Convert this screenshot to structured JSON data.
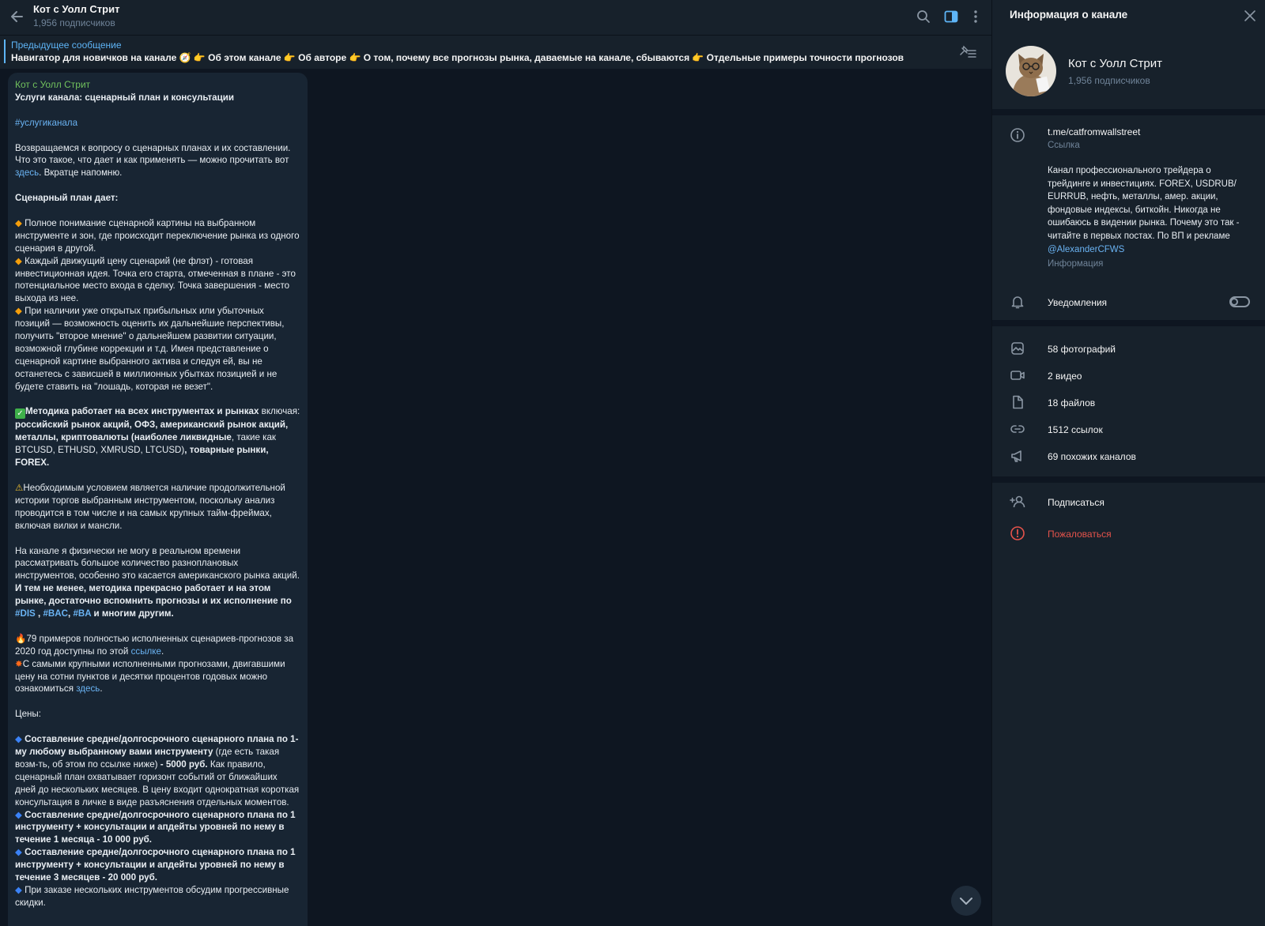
{
  "header": {
    "title": "Кот с Уолл Стрит",
    "subtitle": "1,956 подписчиков"
  },
  "pinned": {
    "label": "Предыдущее сообщение",
    "text": "Навигатор для новичков на канале 🧭 👉 Об этом канале 👉 Об авторе 👉 О том, почему все прогнозы рынка, даваемые на канале, сбываются 👉 Отдельные примеры точности прогнозов"
  },
  "message": {
    "author": "Кот с Уолл Стрит",
    "title": "Услуги канала: сценарный план и консультации",
    "hashtag": "#услугиканала",
    "p1_a": "Возвращаемся к вопросу о сценарных планах и их составлении. Что это такое, что дает и как применять — можно прочитать вот ",
    "p1_link": "здесь",
    "p1_b": ". Вкратце напомню.",
    "h_plan": "Сценарный план дает:",
    "b1": "Полное понимание сценарной картины на выбранном инструменте и зон, где происходит переключение рынка из одного сценария в другой.",
    "b2": "Каждый движущий цену сценарий (не флэт) - готовая инвестиционная идея. Точка его старта, отмеченная в плане - это потенциальное место входа в сделку. Точка завершения - место выхода из нее.",
    "b3": "При наличии уже открытых прибыльных или убыточных позиций — возможность оценить их дальнейшие перспективы, получить \"второе мнение\" о дальнейшем развитии ситуации, возможной глубине коррекции и т.д. Имея представление о сценарной картине выбранного актива и следуя ей, вы не останетесь с зависшей в миллионных убытках позицией и не будете  ставить на \"лошадь, которая не везет\".",
    "m_a": "Методика работает на всех инструментах и рынках",
    "m_b": " включая: ",
    "m_c": "российский рынок акций, ОФЗ, американский рынок акций, металлы, криптовалюты (наиболее ликвидные",
    "m_d": ", такие как BTCUSD, ETHUSD, XMRUSD, LTCUSD)",
    "m_e": ", товарные рынки, FOREX.",
    "warn": "Необходимым условием является наличие продолжительной истории торгов выбранным инструментом, поскольку анализ проводится в том числе и на самых крупных тайм-фреймах, включая вилки и мансли.",
    "p5_a": "На канале я физически не могу в реальном времени рассматривать большое количество разноплановых инструментов, особенно это касается американского рынка акций. ",
    "p5_b": "И тем не менее, методика прекрасно работает и на этом рынке, достаточно вспомнить прогнозы и их исполнение по ",
    "tag1": "#DIS",
    "tag2": "#BAC",
    "tag3": "#BA",
    "p5_c": " и многим другим.",
    "f1_a": "79 примеров полностью исполненных сценариев-прогнозов за 2020 год доступны по этой ",
    "f1_link": "ссылке",
    "f2_a": "С самыми крупными исполненными прогнозами, двигавшими цену на сотни пунктов и десятки процентов годовых можно ознакомиться ",
    "f2_link": "здесь",
    "prices": "Цены:",
    "pr1_a": "Составление средне/долгосрочного сценарного плана по 1-му любому выбранному вами инструменту",
    "pr1_b": " (где есть такая возм-ть, об этом по ссылке ниже) ",
    "pr1_c": "- 5000 руб.",
    "pr1_d": " Как правило, сценарный план охватывает горизонт событий от ближайших дней до нескольких месяцев. В цену входит однократная короткая консультация в личке в виде разъяснения отдельных моментов.",
    "pr2": "Составление средне/долгосрочного сценарного плана по 1 инструменту + консультации и апдейты уровней по нему в течение 1 месяца - 10 000 руб.",
    "pr3": "Составление средне/долгосрочного сценарного плана по 1 инструменту + консультации и апдейты уровней по нему в течение 3 месяцев - 20 000 руб.",
    "pr4": "При заказе нескольких инструментов обсудим прогрессивные скидки."
  },
  "panel": {
    "title": "Информация о канале",
    "name": "Кот с Уолл Стрит",
    "subscribers": "1,956 подписчиков",
    "link": "t.me/catfromwallstreet",
    "link_label": "Ссылка",
    "description": "Канал профессионального трейдера о трейдинге и инвестициях. FOREX, USDRUB/ EURRUB, нефть, металлы, амер. акции, фондовые индексы, биткойн. Никогда не ошибаюсь в видении рынка. Почему это так - читайте в первых постах. По ВП и рекламе ",
    "description_mention": "@AlexanderCFWS",
    "info_label": "Информация",
    "notifications": "Уведомления",
    "notifications_on": false,
    "photos": "58 фотографий",
    "videos": "2 видео",
    "files": "18 файлов",
    "links": "1512 ссылок",
    "similar": "69 похожих каналов",
    "subscribe": "Подписаться",
    "report": "Пожаловаться"
  },
  "colors": {
    "accent": "#5eb5f7",
    "author": "#71c15d",
    "danger": "#e5534b",
    "bg": "#0e1621",
    "surface": "#17212b",
    "bubble": "#182533"
  }
}
